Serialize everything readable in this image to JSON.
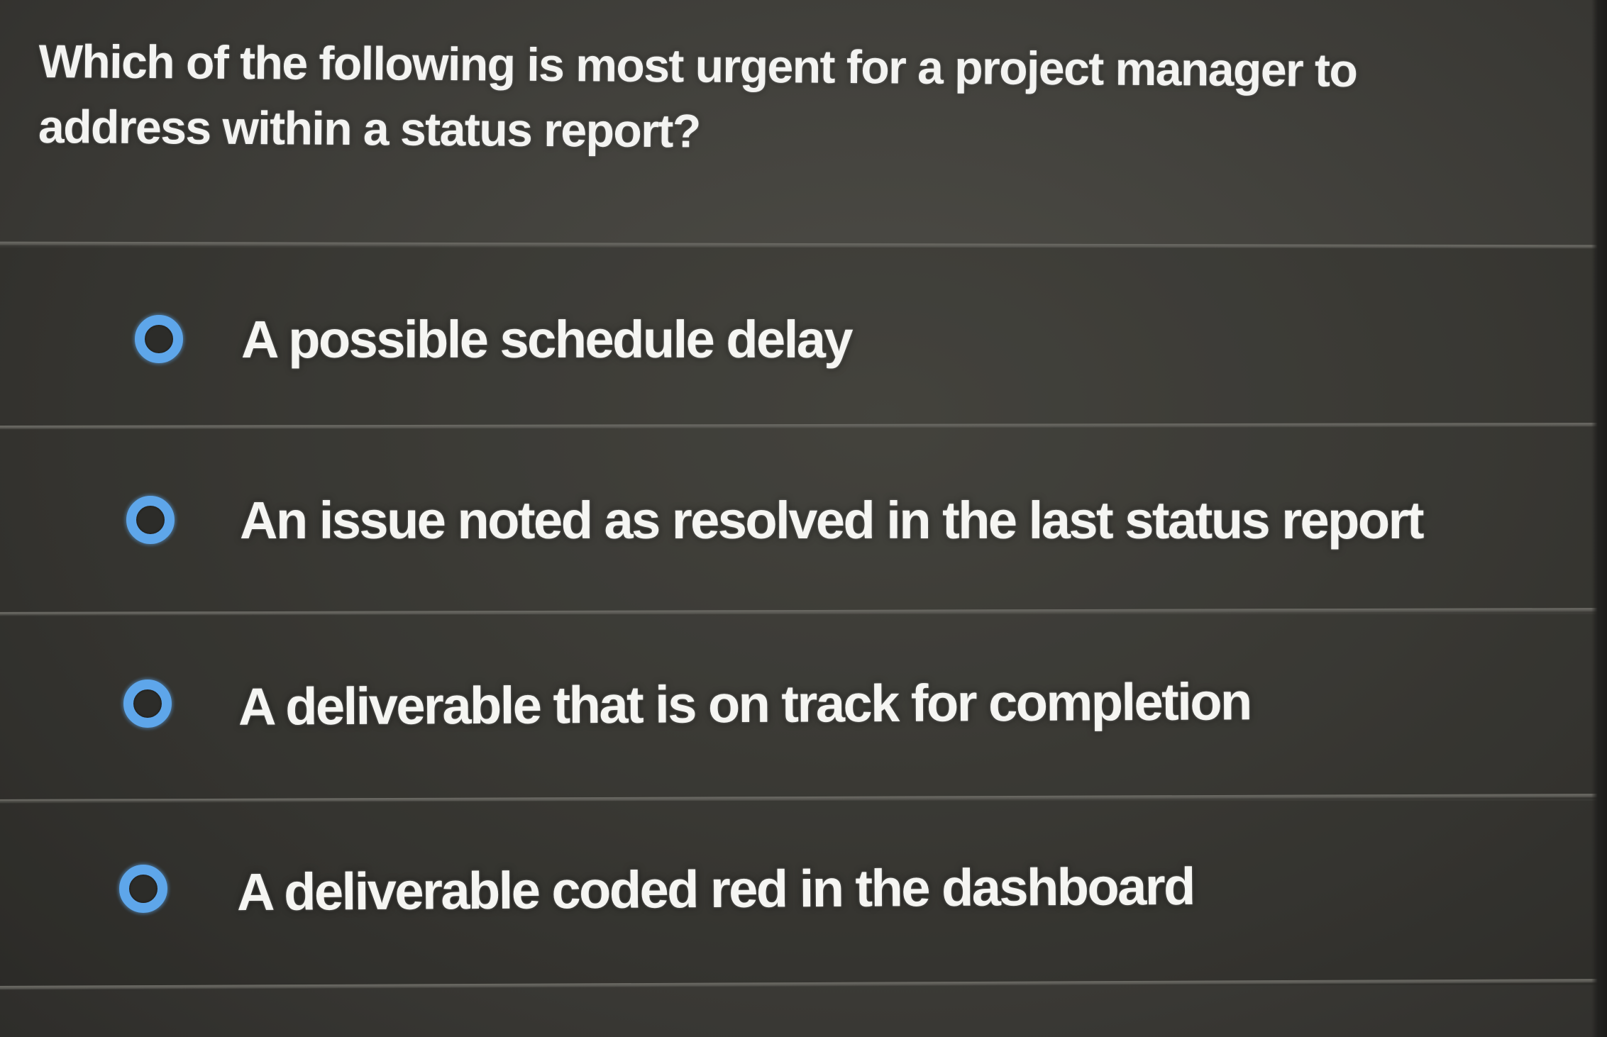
{
  "question": {
    "text": "Which of the following is most urgent for a project manager to address within a status report?"
  },
  "options": [
    {
      "label": "A possible schedule delay",
      "selected": false
    },
    {
      "label": "An issue noted as resolved in the last status report",
      "selected": false
    },
    {
      "label": "A deliverable that is on track for completion",
      "selected": false
    },
    {
      "label": "A deliverable coded red in the dashboard",
      "selected": false
    }
  ],
  "colors": {
    "background": "#44433e",
    "text": "#f5f5f2",
    "radio_accent": "#5ea6ea",
    "divider": "#6d6c66"
  }
}
